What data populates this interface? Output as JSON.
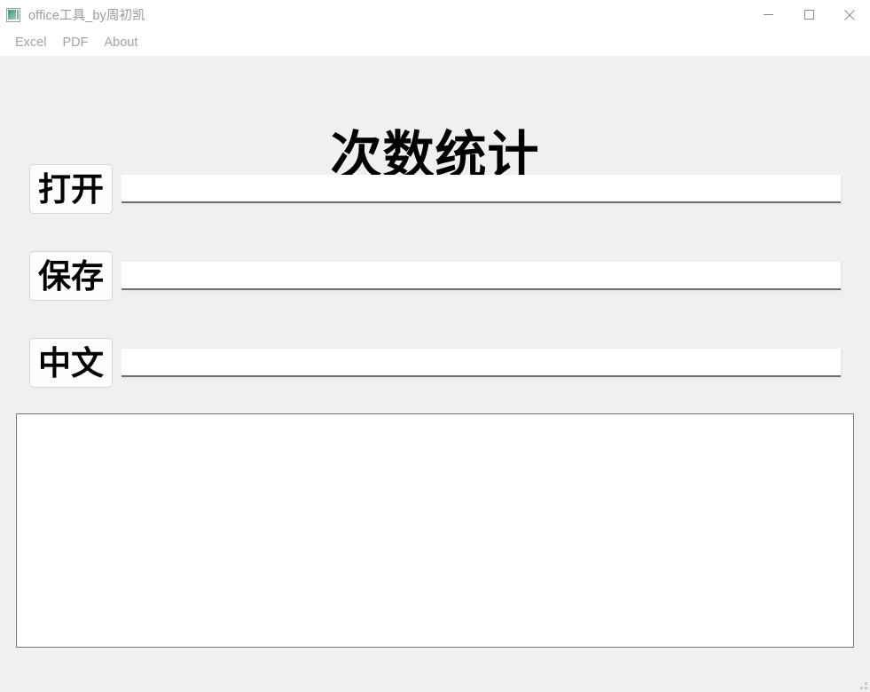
{
  "window": {
    "title": "office工具_by周初凯",
    "icon": "app-image-icon",
    "controls": {
      "minimize": "minimize-icon",
      "maximize": "maximize-icon",
      "close": "close-icon"
    }
  },
  "menubar": {
    "items": [
      {
        "label": "Excel"
      },
      {
        "label": "PDF"
      },
      {
        "label": "About"
      }
    ]
  },
  "main": {
    "heading": "次数统计",
    "rows": [
      {
        "button_label": "打开",
        "input_value": "",
        "input_placeholder": ""
      },
      {
        "button_label": "保存",
        "input_value": "",
        "input_placeholder": ""
      },
      {
        "button_label": "中文",
        "input_value": "",
        "input_placeholder": ""
      }
    ],
    "output": {
      "value": "",
      "placeholder": ""
    }
  },
  "colors": {
    "window_background": "#f0f0f0",
    "titlebar_background": "#ffffff",
    "title_text": "#9b9b9b",
    "menu_text": "#a2a2a2",
    "heading_text": "#000000",
    "input_background": "#ffffff",
    "input_underline": "#6f6f6f",
    "output_border": "#74767c",
    "button_border": "#d6d6d6"
  }
}
